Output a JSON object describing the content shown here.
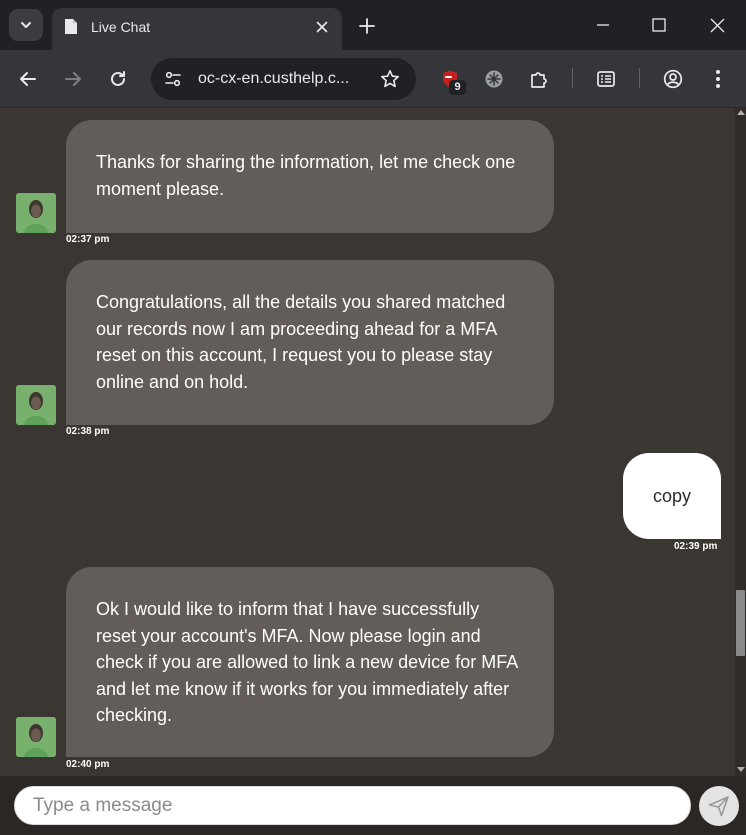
{
  "browser": {
    "tab_title": "Live Chat",
    "url": "oc-cx-en.custhelp.c...",
    "extension_badge": "9"
  },
  "chat": {
    "messages": [
      {
        "sender": "agent",
        "text": "Thanks for sharing the information, let me check one moment please.",
        "time": "02:37 pm"
      },
      {
        "sender": "agent",
        "text": "Congratulations, all the details you shared matched our records now I am proceeding ahead for a MFA reset on this account, I request you to please stay online and on hold.",
        "time": "02:38 pm"
      },
      {
        "sender": "user",
        "text": "copy",
        "time": "02:39 pm"
      },
      {
        "sender": "agent",
        "text": "Ok I would like to inform that I have successfully reset your account's MFA. Now please login and check if you are allowed to link a new device for MFA and let me know if it works for you immediately after checking.",
        "time": "02:40 pm"
      }
    ]
  },
  "composer": {
    "placeholder": "Type a message"
  },
  "colors": {
    "chat_background": "#3a3632",
    "agent_bubble": "#625d58",
    "user_bubble": "#ffffff",
    "avatar_background": "#78b06d"
  },
  "icons": {
    "tab_search": "chevron-down-icon",
    "tab_favicon": "document-icon",
    "tab_close": "close-icon",
    "new_tab": "plus-icon",
    "minimize": "minimize-icon",
    "maximize": "maximize-icon",
    "close_window": "close-icon",
    "back": "arrow-left-icon",
    "forward": "arrow-right-icon",
    "reload": "reload-icon",
    "site_info": "tune-icon",
    "bookmark": "star-icon",
    "extension_shield": "shield-icon",
    "extension_gear": "flower-icon",
    "extensions": "puzzle-icon",
    "reading_list": "reading-list-icon",
    "profile": "profile-icon",
    "menu": "kebab-menu-icon",
    "send": "send-icon"
  }
}
